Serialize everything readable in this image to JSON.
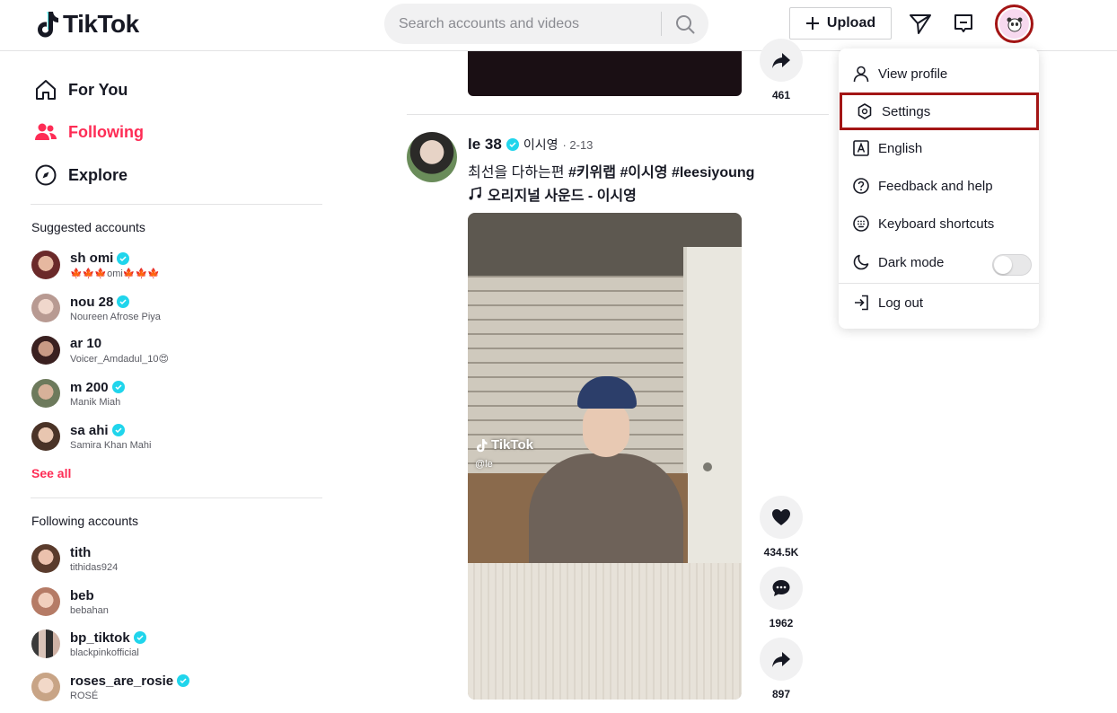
{
  "header": {
    "logo_text": "TikTok",
    "search_placeholder": "Search accounts and videos",
    "upload_label": "Upload"
  },
  "sidebar": {
    "nav": [
      {
        "label": "For You",
        "icon": "home-icon",
        "active": false
      },
      {
        "label": "Following",
        "icon": "following-icon",
        "active": true
      },
      {
        "label": "Explore",
        "icon": "compass-icon",
        "active": false
      }
    ],
    "suggested_title": "Suggested accounts",
    "suggested": [
      {
        "name": "sh omi",
        "sub": "🍁🍁🍁omi🍁🍁🍁",
        "verified": true
      },
      {
        "name": "nou 28",
        "sub": "Noureen Afrose Piya",
        "verified": true
      },
      {
        "name": "ar 10",
        "sub": "Voicer_Amdadul_10😍",
        "verified": false
      },
      {
        "name": "m 200",
        "sub": "Manik Miah",
        "verified": true
      },
      {
        "name": "sa ahi",
        "sub": "Samira Khan Mahi",
        "verified": true
      }
    ],
    "see_all": "See all",
    "following_title": "Following accounts",
    "following": [
      {
        "name": "tith",
        "sub": "tithidas924",
        "verified": false
      },
      {
        "name": "beb",
        "sub": "bebahan",
        "verified": false
      },
      {
        "name": "bp_tiktok",
        "sub": "blackpinkofficial",
        "verified": true
      },
      {
        "name": "roses_are_rosie",
        "sub": "ROSÉ",
        "verified": true
      }
    ]
  },
  "feed": {
    "prev_share_count": "461",
    "post": {
      "username": "le 38",
      "nickname": "이시영",
      "date": "· 2-13",
      "caption_text": "최선을 다하는편 ",
      "caption_tags": "#키위랩 #이시영 #leesiyoung",
      "music": "오리지널 사운드 - 이시영",
      "watermark": "TikTok",
      "watermark_handle": "@le",
      "likes": "434.5K",
      "comments": "1962",
      "shares": "897"
    }
  },
  "menu": {
    "items": [
      {
        "label": "View profile",
        "icon": "person-icon"
      },
      {
        "label": "Settings",
        "icon": "settings-icon"
      },
      {
        "label": "English",
        "icon": "language-icon"
      },
      {
        "label": "Feedback and help",
        "icon": "help-icon"
      },
      {
        "label": "Keyboard shortcuts",
        "icon": "keyboard-icon"
      },
      {
        "label": "Dark mode",
        "icon": "moon-icon"
      },
      {
        "label": "Log out",
        "icon": "logout-icon"
      }
    ],
    "dark_mode_on": false
  },
  "colors": {
    "accent": "#fe2c55",
    "verified": "#20d5ec",
    "highlight_border": "#a31515"
  }
}
